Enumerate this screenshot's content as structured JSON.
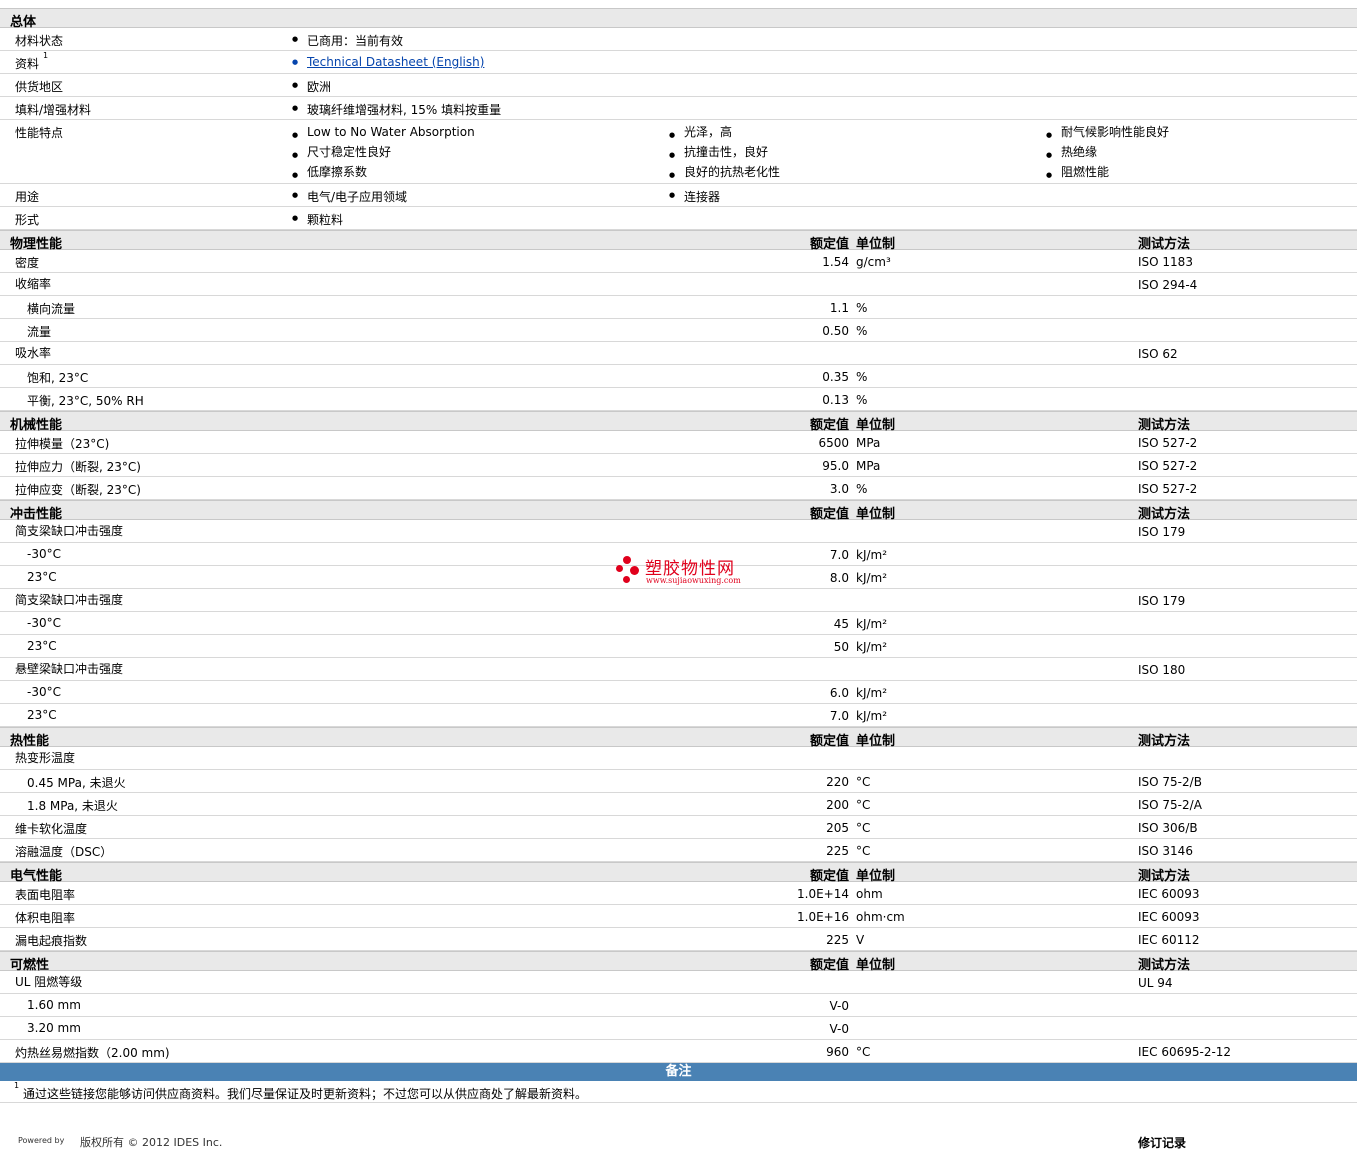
{
  "general": {
    "title": "总体",
    "rows": [
      {
        "label": "材料状态",
        "cols": [
          [
            "已商用：当前有效"
          ]
        ]
      },
      {
        "label": "资料",
        "sup": "1",
        "cols": [
          [
            "Technical Datasheet (English)"
          ]
        ],
        "link": true
      },
      {
        "label": "供货地区",
        "cols": [
          [
            "欧洲"
          ]
        ]
      },
      {
        "label": "填料/增强材料",
        "cols": [
          [
            "玻璃纤维增强材料, 15% 填料按重量"
          ]
        ]
      },
      {
        "label": "性能特点",
        "cols": [
          [
            "Low to No Water Absorption",
            "尺寸稳定性良好",
            "低摩擦系数"
          ],
          [
            "光泽，高",
            "抗撞击性，良好",
            "良好的抗热老化性"
          ],
          [
            "耐气候影响性能良好",
            "热绝缘",
            "阻燃性能"
          ]
        ]
      },
      {
        "label": "用途",
        "cols": [
          [
            "电气/电子应用领域"
          ],
          [
            "连接器"
          ]
        ]
      },
      {
        "label": "形式",
        "cols": [
          [
            "颗粒料"
          ]
        ]
      }
    ]
  },
  "headers": {
    "nominal": "额定值",
    "unit": "单位制",
    "test": "测试方法"
  },
  "sections": [
    {
      "title": "物理性能",
      "rows": [
        {
          "label": "密度",
          "nom": "1.54",
          "unit": "g/cm³",
          "test": "ISO 1183"
        },
        {
          "label": "收缩率",
          "test": "ISO 294-4",
          "group": true
        },
        {
          "label": "横向流量",
          "nom": "1.1",
          "unit": "%",
          "sub": true
        },
        {
          "label": "流量",
          "nom": "0.50",
          "unit": "%",
          "sub": true
        },
        {
          "label": "吸水率",
          "test": "ISO 62",
          "group": true
        },
        {
          "label": "饱和, 23°C",
          "nom": "0.35",
          "unit": "%",
          "sub": true
        },
        {
          "label": "平衡, 23°C, 50% RH",
          "nom": "0.13",
          "unit": "%",
          "sub": true
        }
      ]
    },
    {
      "title": "机械性能",
      "rows": [
        {
          "label": "拉伸模量（23°C)",
          "nom": "6500",
          "unit": "MPa",
          "test": "ISO 527-2"
        },
        {
          "label": "拉伸应力（断裂, 23°C)",
          "nom": "95.0",
          "unit": "MPa",
          "test": "ISO 527-2"
        },
        {
          "label": "拉伸应变（断裂, 23°C)",
          "nom": "3.0",
          "unit": "%",
          "test": "ISO 527-2"
        }
      ]
    },
    {
      "title": "冲击性能",
      "rows": [
        {
          "label": "简支梁缺口冲击强度",
          "test": "ISO 179",
          "group": true
        },
        {
          "label": "-30°C",
          "nom": "7.0",
          "unit": "kJ/m²",
          "sub": true
        },
        {
          "label": "23°C",
          "nom": "8.0",
          "unit": "kJ/m²",
          "sub": true
        },
        {
          "label": "简支梁缺口冲击强度",
          "test": "ISO 179",
          "group": true
        },
        {
          "label": "-30°C",
          "nom": "45",
          "unit": "kJ/m²",
          "sub": true
        },
        {
          "label": "23°C",
          "nom": "50",
          "unit": "kJ/m²",
          "sub": true
        },
        {
          "label": "悬壁梁缺口冲击强度",
          "test": "ISO 180",
          "group": true
        },
        {
          "label": "-30°C",
          "nom": "6.0",
          "unit": "kJ/m²",
          "sub": true
        },
        {
          "label": "23°C",
          "nom": "7.0",
          "unit": "kJ/m²",
          "sub": true
        }
      ]
    },
    {
      "title": "热性能",
      "rows": [
        {
          "label": "热变形温度",
          "group": true
        },
        {
          "label": "0.45 MPa, 未退火",
          "nom": "220",
          "unit": "°C",
          "test": "ISO 75-2/B",
          "sub": true
        },
        {
          "label": "1.8 MPa, 未退火",
          "nom": "200",
          "unit": "°C",
          "test": "ISO 75-2/A",
          "sub": true
        },
        {
          "label": "维卡软化温度",
          "nom": "205",
          "unit": "°C",
          "test": "ISO 306/B"
        },
        {
          "label": "溶融温度（DSC）",
          "nom": "225",
          "unit": "°C",
          "test": "ISO 3146"
        }
      ]
    },
    {
      "title": "电气性能",
      "rows": [
        {
          "label": "表面电阻率",
          "nom": "1.0E+14",
          "unit": "ohm",
          "test": "IEC 60093"
        },
        {
          "label": "体积电阻率",
          "nom": "1.0E+16",
          "unit": "ohm·cm",
          "test": "IEC 60093"
        },
        {
          "label": "漏电起痕指数",
          "nom": "225",
          "unit": "V",
          "test": "IEC 60112"
        }
      ]
    },
    {
      "title": "可燃性",
      "rows": [
        {
          "label": "UL 阻燃等级",
          "test": "UL 94",
          "group": true
        },
        {
          "label": "1.60 mm",
          "nom": "V-0",
          "sub": true
        },
        {
          "label": "3.20 mm",
          "nom": "V-0",
          "sub": true
        },
        {
          "label": "灼热丝易燃指数（2.00 mm)",
          "nom": "960",
          "unit": "°C",
          "test": "IEC 60695-2-12"
        }
      ]
    }
  ],
  "notes": {
    "title": "备注",
    "sup": "1",
    "text": "通过这些链接您能够访问供应商资料。我们尽量保证及时更新资料；不过您可以从供应商处了解最新资料。"
  },
  "footer": {
    "powered": "Powered by",
    "copyright": "版权所有 © 2012 IDES Inc.",
    "revision": "修订记录"
  },
  "watermark": {
    "title": "塑胶物性网",
    "url": "www.sujiaowuxing.com"
  }
}
